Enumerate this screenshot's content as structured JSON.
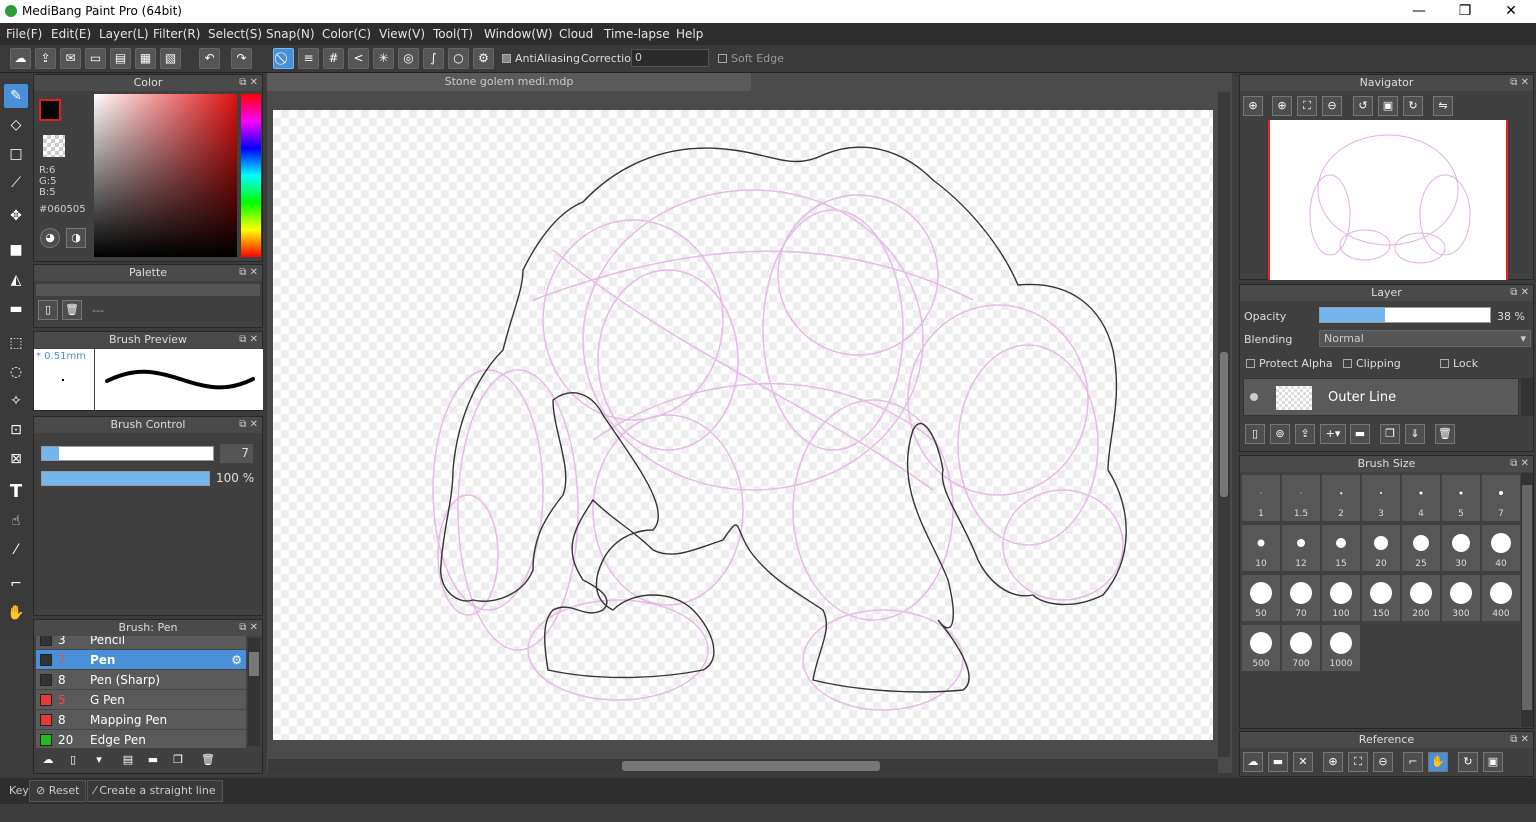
{
  "window": {
    "title": "MediBang Paint Pro (64bit)",
    "min": "—",
    "max": "❐",
    "close": "✕"
  },
  "menu": [
    "File(F)",
    "Edit(E)",
    "Layer(L)",
    "Filter(R)",
    "Select(S)",
    "Snap(N)",
    "Color(C)",
    "View(V)",
    "Tool(T)",
    "Window(W)",
    "Cloud",
    "Time-lapse",
    "Help"
  ],
  "toolbar": {
    "antialiasing": "AntiAliasing",
    "correction_label": "Correction",
    "correction_value": "0",
    "soft_edge": "Soft Edge"
  },
  "color_panel": {
    "title": "Color",
    "r": "R:6",
    "g": "G:5",
    "b": "B:5",
    "hex": "#060505",
    "fg": "#060505"
  },
  "palette_panel": {
    "title": "Palette",
    "placeholder": "---"
  },
  "brush_preview": {
    "title": "Brush Preview",
    "size": "* 0.51mm"
  },
  "brush_control": {
    "title": "Brush Control",
    "size": "7",
    "opacity": "100 %",
    "size_fraction": 0.1,
    "opacity_fraction": 1.0
  },
  "brush_list": {
    "title": "Brush: Pen",
    "items": [
      {
        "size": "3",
        "name": "Pencil",
        "color": "#333333"
      },
      {
        "size": "7",
        "name": "Pen",
        "color": "#333333",
        "selected": true
      },
      {
        "size": "8",
        "name": "Pen (Sharp)",
        "color": "#333333"
      },
      {
        "size": "5",
        "name": "G Pen",
        "color": "#e83a3a"
      },
      {
        "size": "8",
        "name": "Mapping Pen",
        "color": "#e83a3a"
      },
      {
        "size": "20",
        "name": "Edge Pen",
        "color": "#22bb22"
      }
    ]
  },
  "document": {
    "tab": "Stone golem medi.mdp"
  },
  "navigator": {
    "title": "Navigator"
  },
  "layer_panel": {
    "title": "Layer",
    "opacity_label": "Opacity",
    "opacity_value": "38 %",
    "opacity_fraction": 0.38,
    "blending_label": "Blending",
    "blending_value": "Normal",
    "protect_alpha": "Protect Alpha",
    "clipping": "Clipping",
    "lock": "Lock",
    "layer_name": "Outer Line"
  },
  "brush_size": {
    "title": "Brush Size",
    "sizes": [
      "1",
      "1.5",
      "2",
      "3",
      "4",
      "5",
      "7",
      "10",
      "12",
      "15",
      "20",
      "25",
      "30",
      "40",
      "50",
      "70",
      "100",
      "150",
      "200",
      "300",
      "400",
      "500",
      "700",
      "1000"
    ]
  },
  "reference": {
    "title": "Reference"
  },
  "status": {
    "key": "Key",
    "reset": "Reset",
    "straight": "Create a straight line"
  }
}
